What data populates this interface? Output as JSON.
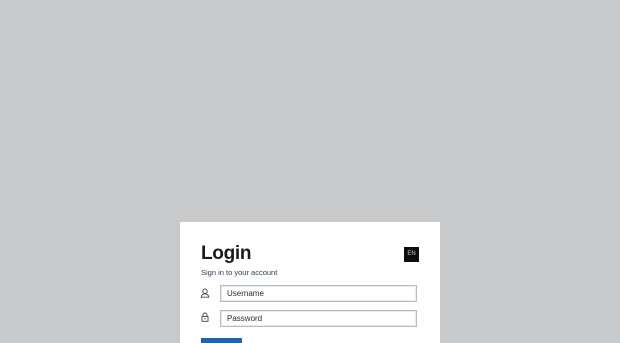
{
  "login": {
    "title": "Login",
    "subtitle": "Sign in to your account",
    "language_label": "EN",
    "username_placeholder": "Username",
    "password_placeholder": "Password",
    "submit_label": ""
  },
  "colors": {
    "background": "#c8c9cb",
    "card": "#ffffff",
    "primary_button": "#1f64a6",
    "language_button": "#0d0d0d"
  },
  "icons": {
    "username": "user-icon",
    "password": "lock-icon"
  }
}
